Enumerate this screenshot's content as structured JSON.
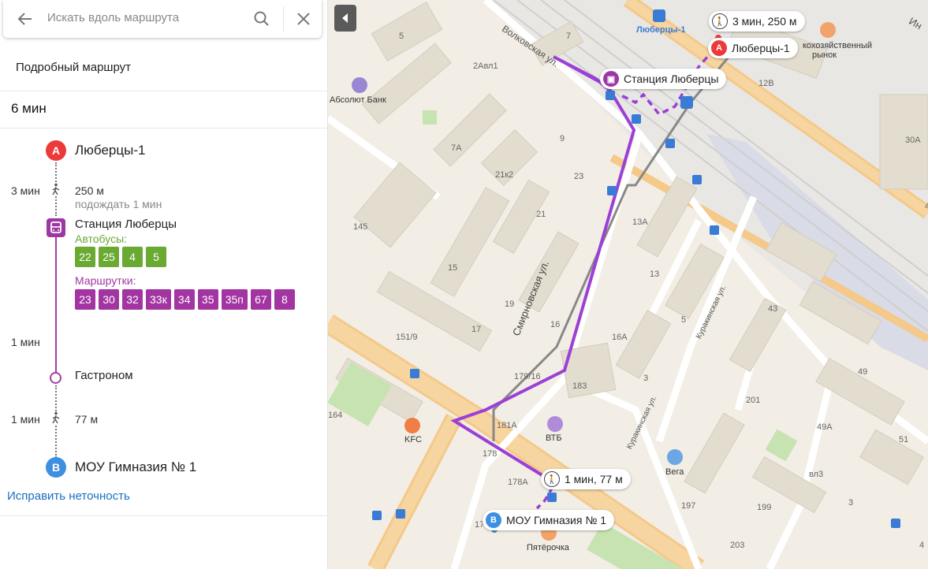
{
  "search": {
    "placeholder": "Искать вдоль маршрута"
  },
  "route": {
    "detail_title": "Подробный маршрут",
    "duration": "6 мин",
    "start": {
      "marker": "A",
      "name": "Люберцы-1"
    },
    "walk1": {
      "minutes": "3 мин",
      "distance": "250 м",
      "wait": "подождать 1 мин"
    },
    "stop": {
      "name": "Станция Люберцы",
      "buses_label": "Автобусы:",
      "buses": [
        "22",
        "25",
        "4",
        "5"
      ],
      "minibuses_label": "Маршрутки:",
      "minibuses": [
        "23",
        "30",
        "32",
        "33к",
        "34",
        "35",
        "35п",
        "67",
        "8"
      ]
    },
    "ride": {
      "minutes": "1 мин"
    },
    "middle_stop": {
      "name": "Гастроном"
    },
    "walk2": {
      "minutes": "1 мин",
      "distance": "77 м"
    },
    "end": {
      "marker": "B",
      "name": "МОУ Гимназия № 1"
    },
    "fix_link": "Исправить неточность"
  },
  "colors": {
    "route": "#9b3fd6",
    "bus": "#6aaa33",
    "minibus": "#a335a2",
    "pin_a": "#ec3a3a",
    "pin_b": "#3d8fe0",
    "link": "#1a6fc4"
  },
  "map": {
    "bubbles": {
      "walk_start": "3 мин, 250 м",
      "start": "Люберцы-1",
      "stop": "Станция Люберцы",
      "walk_end": "1 мин, 77 м",
      "end": "МОУ Гимназия № 1"
    },
    "pois": {
      "station": "Люберцы-1",
      "market_1": "кохозяйственный",
      "market_2": "рынок",
      "bank": "Абсолют Банк",
      "kfc": "KFC",
      "vtb": "ВТБ",
      "vega": "Вега",
      "pyaterochka": "Пятёрочка"
    },
    "streets": {
      "volkovskaya": "Волковская ул.",
      "smirnovskaya": "Смирновская ул.",
      "kurakinskaya1": "Куракинская ул.",
      "kurakinskaya2": "Куракинская ул.",
      "top_right": "Ин"
    },
    "house_numbers": [
      "5",
      "2Авл1",
      "7",
      "12В",
      "30А",
      "9",
      "7А",
      "21к2",
      "23",
      "21",
      "13А",
      "145",
      "15",
      "13",
      "43",
      "19",
      "5",
      "16",
      "17",
      "16А",
      "151/9",
      "49",
      "179/16",
      "183",
      "3",
      "201",
      "49А",
      "164",
      "181А",
      "178",
      "178А",
      "51",
      "вл3",
      "197",
      "199",
      "3",
      "203",
      "4",
      "4",
      "178"
    ]
  }
}
